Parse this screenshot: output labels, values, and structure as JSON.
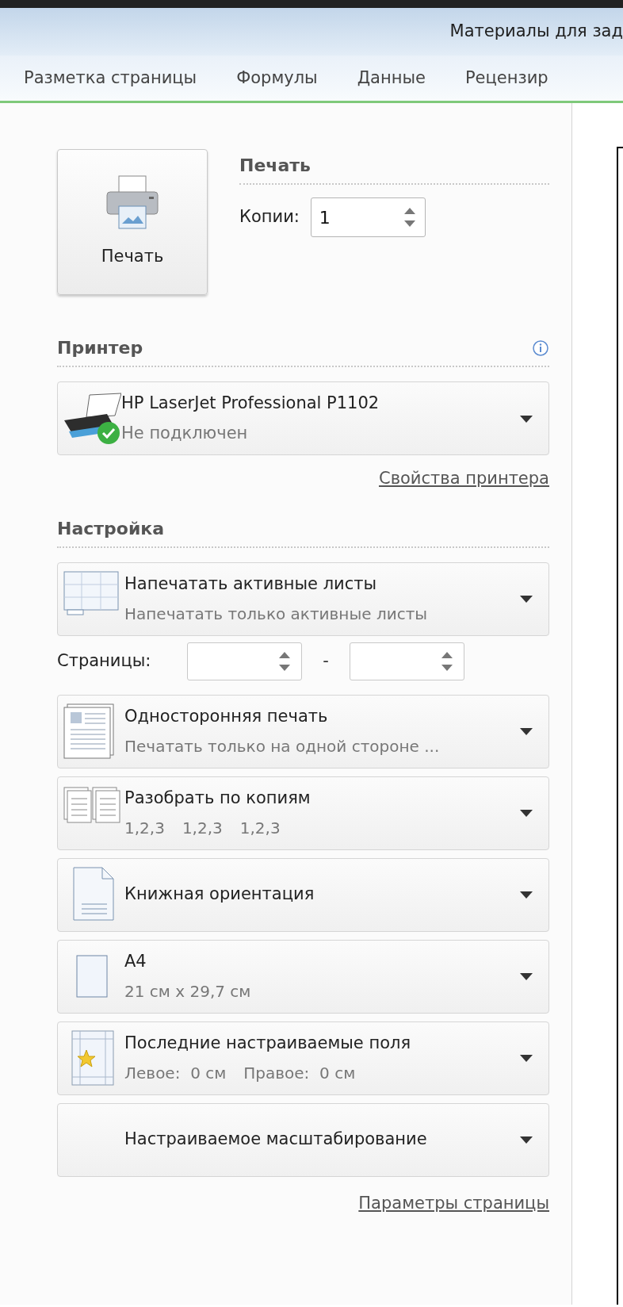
{
  "window": {
    "title": "Материалы для зад"
  },
  "ribbon_tabs": [
    {
      "label": "Разметка страницы",
      "selected": false
    },
    {
      "label": "Формулы",
      "selected": false
    },
    {
      "label": "Данные",
      "selected": false
    },
    {
      "label": "Рецензир",
      "selected": false
    }
  ],
  "print": {
    "heading": "Печать",
    "button_label": "Печать",
    "copies_label": "Копии:",
    "copies_value": "1"
  },
  "printer": {
    "heading": "Принтер",
    "name": "HP LaserJet Professional P1102",
    "status": "Не подключен",
    "properties_link": "Свойства принтера"
  },
  "settings": {
    "heading": "Настройка",
    "pages": {
      "label": "Страницы:",
      "separator": "-"
    },
    "options": [
      {
        "kind": "sheets",
        "title": "Напечатать активные листы",
        "subtitle": [
          "Напечатать только активные листы"
        ]
      },
      {
        "kind": "sides",
        "title": "Односторонняя печать",
        "subtitle": [
          "Печатать только на одной стороне ..."
        ]
      },
      {
        "kind": "collate",
        "title": "Разобрать по копиям",
        "subtitle": [
          "1,2,3",
          "1,2,3",
          "1,2,3"
        ]
      },
      {
        "kind": "orientation",
        "title": "Книжная ориентация"
      },
      {
        "kind": "paper",
        "title": "A4",
        "subtitle": [
          "21 см x 29,7 см"
        ]
      },
      {
        "kind": "margins",
        "title": "Последние настраиваемые поля",
        "subtitle": [
          "Левое:  0 см",
          "Правое:  0 см"
        ]
      },
      {
        "kind": "scaling",
        "title": "Настраиваемое масштабирование"
      }
    ],
    "page_setup_link": "Параметры страницы"
  }
}
